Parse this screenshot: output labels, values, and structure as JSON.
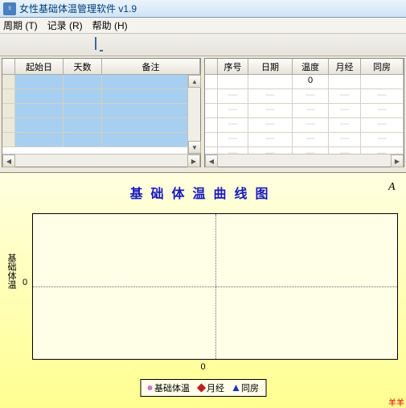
{
  "window": {
    "title": "女性基础体温管理软件 v1.9"
  },
  "menu": {
    "period": "周期 (T)",
    "record": "记录 (R)",
    "help": "帮助 (H)"
  },
  "left_table": {
    "headers": {
      "blank": "",
      "start_date": "起始日",
      "days": "天数",
      "remark": "备注"
    },
    "row_count": 5
  },
  "right_table": {
    "headers": {
      "blank": "",
      "seq": "序号",
      "date": "日期",
      "temperature": "温度",
      "menses": "月经",
      "intercourse": "同房"
    },
    "first_row_temperature": "0",
    "extra_row_count": 5
  },
  "chart_data": {
    "type": "line",
    "title": "基础体温曲线图",
    "ylabel": "基础体温",
    "xlabel": "",
    "x": [
      0
    ],
    "y_tick": "0",
    "x_tick": "0",
    "series": [
      {
        "name": "基础体温",
        "marker": "dot",
        "color": "#d070d0",
        "values": []
      },
      {
        "name": "月经",
        "marker": "diamond",
        "color": "#c02020",
        "values": []
      },
      {
        "name": "同房",
        "marker": "triangle",
        "color": "#2030c0",
        "values": []
      }
    ]
  },
  "footer": {
    "link_text": "羊羊"
  },
  "icons": {
    "print_glyph": "A"
  }
}
